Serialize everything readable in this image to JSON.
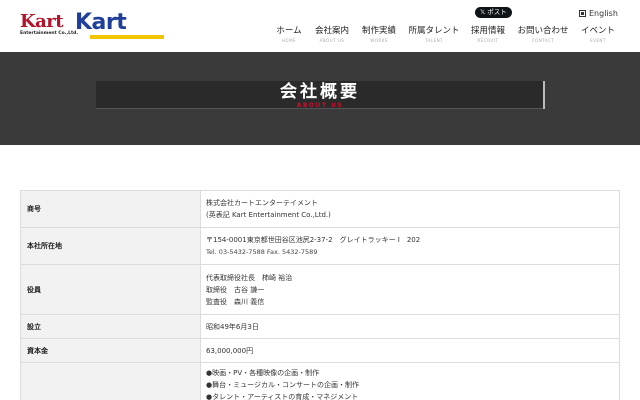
{
  "logo": {
    "left_word": "Kart",
    "left_sub": "Entertainment Co.,Ltd.",
    "right_word": "Kart"
  },
  "header": {
    "x_post_label": "𝕏 ポスト",
    "english_label": "English"
  },
  "nav": [
    {
      "jp": "ホーム",
      "en": "HOME"
    },
    {
      "jp": "会社案内",
      "en": "ABOUT US"
    },
    {
      "jp": "制作実績",
      "en": "WORKS"
    },
    {
      "jp": "所属タレント",
      "en": "TALENT"
    },
    {
      "jp": "採用情報",
      "en": "RECRUIT"
    },
    {
      "jp": "お問い合わせ",
      "en": "CONTACT"
    },
    {
      "jp": "イベント",
      "en": "EVENT"
    }
  ],
  "hero": {
    "title": "会社概要",
    "subtitle": "ABOUT US"
  },
  "company_table": {
    "rows": [
      {
        "label": "商号",
        "lines": [
          "株式会社カートエンターテイメント",
          "(英表記 Kart Entertainment Co.,Ltd.)"
        ]
      },
      {
        "label": "本社所在地",
        "lines": [
          "〒154-0001東京都世田谷区池尻2-37-2　グレイトラッキー I　202",
          "Tel. 03-5432-7588 Fax. 5432-7589"
        ]
      },
      {
        "label": "役員",
        "lines": [
          "代表取締役社長　柿崎 裕治",
          "取締役　古谷 謙一",
          "監査役　森川 義信"
        ]
      },
      {
        "label": "設立",
        "lines": [
          "昭和49年6月3日"
        ]
      },
      {
        "label": "資本金",
        "lines": [
          "63,000,000円"
        ]
      },
      {
        "label": "",
        "lines": [
          "●映画・PV・各種映像の企画・制作",
          "●舞台・ミュージカル・コンサートの企画・制作",
          "●タレント・アーティストの育成・マネジメント"
        ]
      }
    ]
  }
}
